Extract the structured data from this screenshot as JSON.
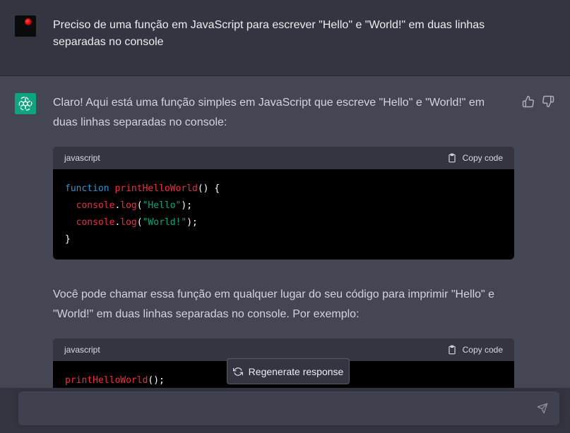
{
  "user_message": {
    "text": "Preciso de uma função em JavaScript para escrever \"Hello\" e \"World!\" em duas linhas separadas no console"
  },
  "assistant_message": {
    "intro": "Claro! Aqui está uma função simples em JavaScript que escreve \"Hello\" e \"World!\" em duas linhas separadas no console:",
    "code_block_1": {
      "language": "javascript",
      "copy_label": "Copy code",
      "lines": [
        {
          "kw": "function",
          "fn": "printHelloWorld",
          "rest": "() {"
        },
        {
          "obj": "console",
          "method": "log",
          "arg": "\"Hello\""
        },
        {
          "obj": "console",
          "method": "log",
          "arg": "\"World!\""
        },
        {
          "close": "}"
        }
      ]
    },
    "followup": "Você pode chamar essa função em qualquer lugar do seu código para imprimir \"Hello\" e \"World!\" em duas linhas separadas no console. Por exemplo:",
    "code_block_2": {
      "language": "javascript",
      "copy_label": "Copy code",
      "call_fn": "printHelloWorld",
      "call_rest": "();"
    }
  },
  "regenerate_label": "Regenerate response",
  "icons": {
    "thumbs_up": "thumbs-up-icon",
    "thumbs_down": "thumbs-down-icon",
    "copy": "clipboard-icon",
    "regenerate": "refresh-icon",
    "send": "send-icon",
    "bot": "openai-logo-icon"
  },
  "colors": {
    "page_bg": "#444654",
    "user_bg": "#343541",
    "bot_avatar": "#10a37f",
    "keyword": "#2e95d3",
    "function": "#f22c3d",
    "string": "#00a67d"
  }
}
